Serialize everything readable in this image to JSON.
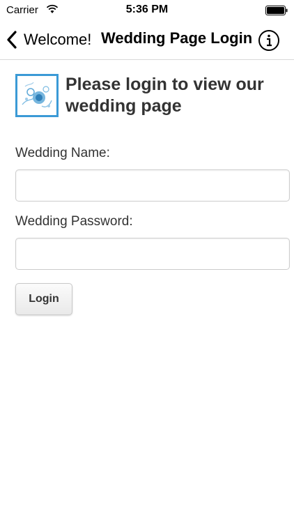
{
  "status_bar": {
    "carrier": "Carrier",
    "time": "5:36 PM",
    "wifi_icon": "wifi-icon",
    "battery_icon": "battery-icon"
  },
  "nav": {
    "back_label": "Welcome!",
    "title": "Wedding Page Login",
    "back_icon": "chevron-left-icon",
    "info_icon": "info-icon"
  },
  "content": {
    "logo_icon": "floral-logo",
    "heading": "Please login to view our wedding page",
    "wedding_name_label": "Wedding Name:",
    "wedding_name_value": "",
    "wedding_password_label": "Wedding Password:",
    "wedding_password_value": "",
    "login_label": "Login"
  },
  "colors": {
    "logo_border": "#3b9ad6",
    "text": "#333333"
  }
}
